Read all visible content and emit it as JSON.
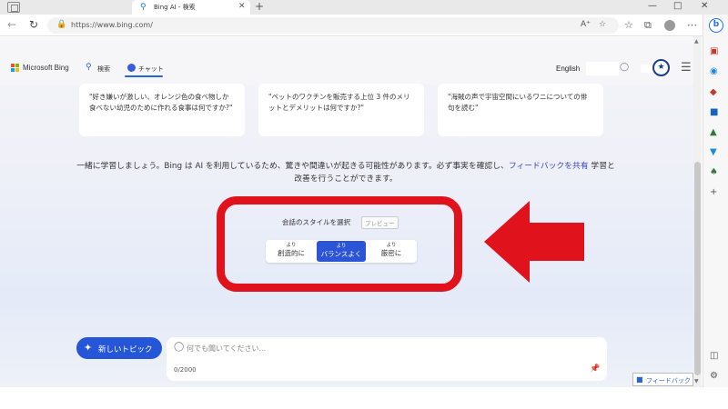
{
  "browser": {
    "tab_title": "Bing AI - 検索",
    "url": "https://www.bing.com/"
  },
  "header": {
    "brand": "Microsoft Bing",
    "nav_search": "検索",
    "nav_chat": "チャット",
    "language": "English"
  },
  "prompts": [
    "\"好き嫌いが激しい、オレンジ色の食べ物しか食べない幼児のために作れる食事は何ですか?\"",
    "\"ペットのワクチンを販売する上位 3 件のメリットとデメリットは何ですか?\"",
    "\"海賊の声で宇宙空間にいるワニについての俳句を読む\""
  ],
  "disclaimer": {
    "text_before": "一緒に学習しましょう。Bing は AI を利用しているため、驚きや間違いが起きる可能性があります。必ず事実を確認し、",
    "link": "フィードバックを共有",
    "text_after": " 学習と改善を行うことができます。"
  },
  "style_selector": {
    "title": "会話のスタイルを選択",
    "badge": "プレビュー",
    "options": [
      {
        "small": "より",
        "main": "創造的に",
        "active": false
      },
      {
        "small": "より",
        "main": "バランスよく",
        "active": true
      },
      {
        "small": "より",
        "main": "厳密に",
        "active": false
      }
    ]
  },
  "chat": {
    "new_topic": "新しいトピック",
    "placeholder": "何でも聞いてください...",
    "char_count": "0/2000"
  },
  "feedback_label": "フィードバック",
  "colors": {
    "accent": "#2656d8",
    "annotation_red": "#e0121b"
  }
}
